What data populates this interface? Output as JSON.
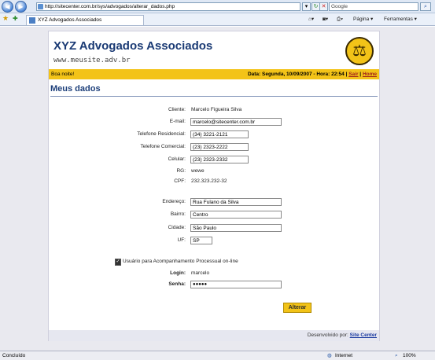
{
  "browser": {
    "url": "http://sitecenter.com.br/sys/advogados/alterar_dados.php",
    "search_placeholder": "Google",
    "tab_title": "XYZ Advogados Associados",
    "cmd_page": "Página ▾",
    "cmd_tools": "Ferramentas ▾",
    "status_left": "Concluído",
    "status_zone": "Internet",
    "zoom": "100%"
  },
  "header": {
    "logo_text": "XYZ Advogados Associados",
    "site": "www.meusite.adv.br",
    "greeting": "Boa noite!",
    "date_info": "Data: Segunda, 10/09/2007 - Hora: 22:54 | ",
    "link_exit": "Sair",
    "separator": " | ",
    "link_home": "Home"
  },
  "page_title": "Meus dados",
  "form": {
    "client_label": "Cliente:",
    "client_value": "Marcelo Figueira Silva",
    "email_label": "E-mail:",
    "email_value": "marcelo@sitecenter.com.br",
    "phone_res_label": "Telefone Residencial:",
    "phone_res_value": "(34) 3221-2121",
    "phone_com_label": "Telefone Comercial:",
    "phone_com_value": "(23) 2323-2222",
    "cell_label": "Celular:",
    "cell_value": "(23) 2323-2332",
    "rg_label": "RG:",
    "rg_value": "wewe",
    "cpf_label": "CPF:",
    "cpf_value": "232.323.232-32",
    "address_label": "Endereço:",
    "address_value": "Rua Fulano da Silva",
    "district_label": "Bairro:",
    "district_value": "Centro",
    "city_label": "Cidade:",
    "city_value": "São Paulo",
    "uf_label": "UF:",
    "uf_value": "SP",
    "tracking_label": "Usuário para Acompanhamento Processual on-line",
    "login_label": "Login:",
    "login_value": "marcelo",
    "password_label": "Senha:",
    "password_value": "●●●●●",
    "submit_label": "Alterar"
  },
  "footer": {
    "text": "Desenvolvido por: ",
    "link": "Site Center"
  }
}
